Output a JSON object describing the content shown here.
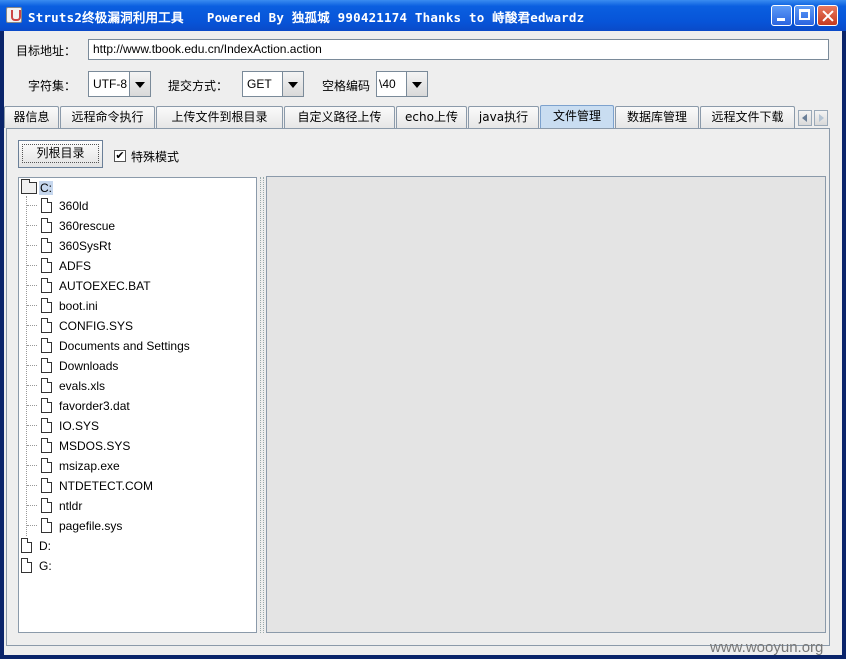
{
  "window": {
    "title": "Struts2终极漏洞利用工具   Powered By 独孤城 990421174 Thanks to 峙酸君edwardz"
  },
  "form": {
    "target_label": "目标地址：",
    "target_value": "http://www.tbook.edu.cn/IndexAction.action",
    "charset_label": "字符集：",
    "charset_value": "UTF-8",
    "method_label": "提交方式：",
    "method_value": "GET",
    "space_label": "空格编码",
    "space_value": "\\40"
  },
  "tabs": [
    {
      "label": "器信息"
    },
    {
      "label": "远程命令执行"
    },
    {
      "label": "上传文件到根目录"
    },
    {
      "label": "自定义路径上传"
    },
    {
      "label": "echo上传"
    },
    {
      "label": "java执行"
    },
    {
      "label": "文件管理",
      "active": true
    },
    {
      "label": "数据库管理"
    },
    {
      "label": "远程文件下载"
    }
  ],
  "file_manager": {
    "list_root_button": "列根目录",
    "special_mode_label": "特殊模式",
    "special_mode_checked": true,
    "check_mark": "✔",
    "tree": {
      "root": "C:",
      "children": [
        "360ld",
        "360rescue",
        "360SysRt",
        "ADFS",
        "AUTOEXEC.BAT",
        "boot.ini",
        "CONFIG.SYS",
        "Documents and Settings",
        "Downloads",
        "evals.xls",
        "favorder3.dat",
        "IO.SYS",
        "MSDOS.SYS",
        "msizap.exe",
        "NTDETECT.COM",
        "ntldr",
        "pagefile.sys"
      ],
      "other_drives": [
        "D:",
        "G:"
      ]
    }
  },
  "watermark": "www.wooyun.org"
}
